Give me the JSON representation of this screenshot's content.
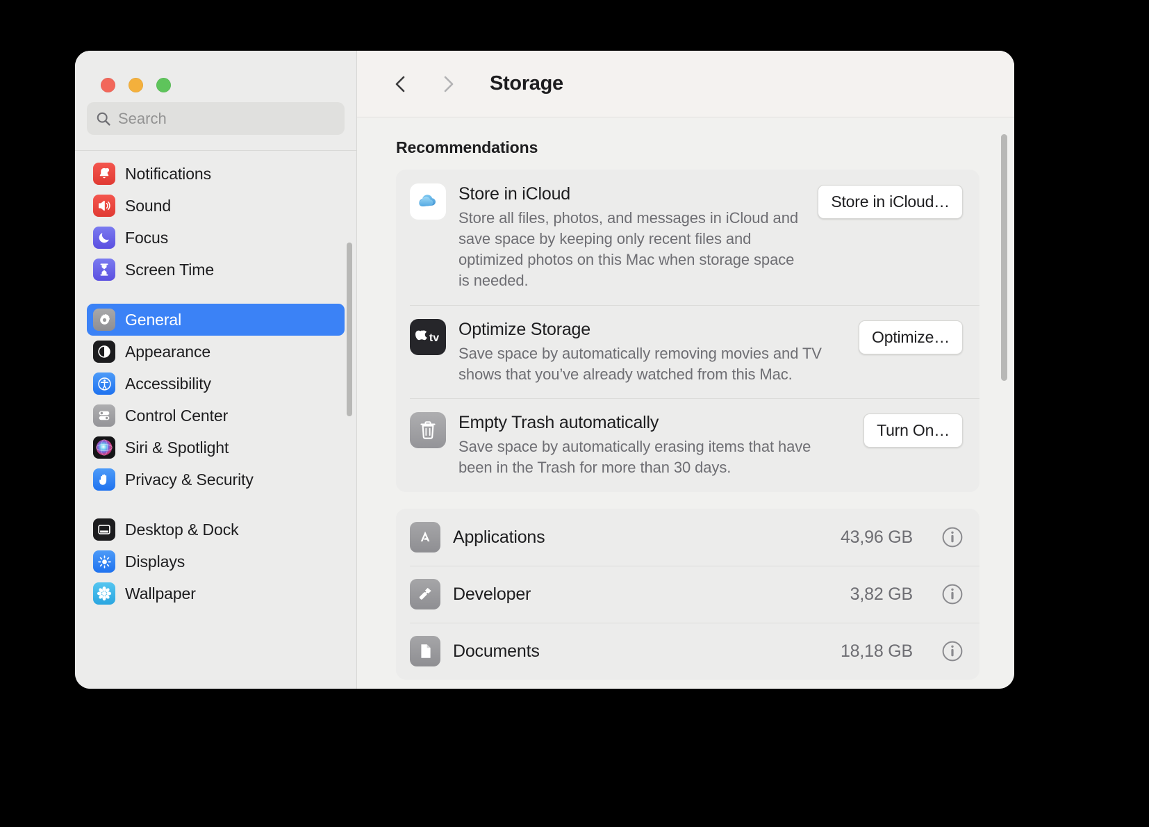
{
  "window": {
    "traffic_lights": [
      "close",
      "minimize",
      "zoom"
    ]
  },
  "sidebar": {
    "search": {
      "placeholder": "Search",
      "value": ""
    },
    "groups": [
      {
        "items": [
          {
            "label": "Notifications",
            "icon": "notifications-icon",
            "selected": false
          },
          {
            "label": "Sound",
            "icon": "sound-icon",
            "selected": false
          },
          {
            "label": "Focus",
            "icon": "focus-icon",
            "selected": false
          },
          {
            "label": "Screen Time",
            "icon": "screen-time-icon",
            "selected": false
          }
        ]
      },
      {
        "items": [
          {
            "label": "General",
            "icon": "general-gear-icon",
            "selected": true
          },
          {
            "label": "Appearance",
            "icon": "appearance-icon",
            "selected": false
          },
          {
            "label": "Accessibility",
            "icon": "accessibility-icon",
            "selected": false
          },
          {
            "label": "Control Center",
            "icon": "control-center-icon",
            "selected": false
          },
          {
            "label": "Siri & Spotlight",
            "icon": "siri-icon",
            "selected": false
          },
          {
            "label": "Privacy & Security",
            "icon": "privacy-security-icon",
            "selected": false
          }
        ]
      },
      {
        "items": [
          {
            "label": "Desktop & Dock",
            "icon": "desktop-dock-icon",
            "selected": false
          },
          {
            "label": "Displays",
            "icon": "displays-icon",
            "selected": false
          },
          {
            "label": "Wallpaper",
            "icon": "wallpaper-icon",
            "selected": false
          }
        ]
      }
    ]
  },
  "toolbar": {
    "back_label": "Back",
    "forward_label": "Forward",
    "title": "Storage"
  },
  "main": {
    "recommendations_heading": "Recommendations",
    "recommendations": [
      {
        "icon": "icloud-icon",
        "title": "Store in iCloud",
        "description": "Store all files, photos, and messages in iCloud and save space by keeping only recent files and optimized photos on this Mac when storage space is needed.",
        "button": "Store in iCloud…"
      },
      {
        "icon": "apple-tv-icon",
        "title": "Optimize Storage",
        "description": "Save space by automatically removing movies and TV shows that you’ve already watched from this Mac.",
        "button": "Optimize…"
      },
      {
        "icon": "trash-icon",
        "title": "Empty Trash automatically",
        "description": "Save space by automatically erasing items that have been in the Trash for more than 30 days.",
        "button": "Turn On…"
      }
    ],
    "storage_items": [
      {
        "icon": "app-store-icon",
        "name": "Applications",
        "size": "43,96 GB",
        "info": "info-icon"
      },
      {
        "icon": "developer-hammer-icon",
        "name": "Developer",
        "size": "3,82 GB",
        "info": "info-icon"
      },
      {
        "icon": "documents-icon",
        "name": "Documents",
        "size": "18,18 GB",
        "info": "info-icon"
      }
    ]
  },
  "colors": {
    "accent": "#3b82f6",
    "window_bg": "#f1f1ef",
    "sidebar_bg": "#ececeb",
    "card_bg": "#ececeb",
    "secondary_text": "#6e6e73"
  }
}
